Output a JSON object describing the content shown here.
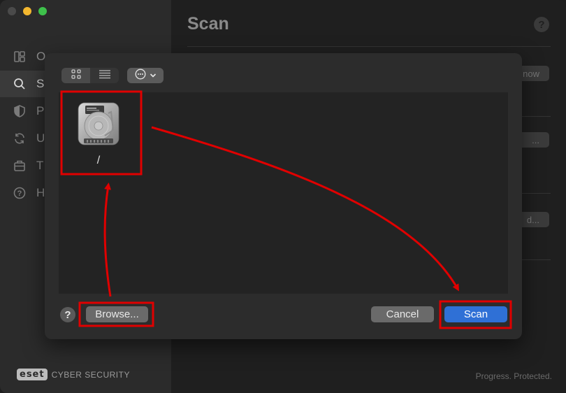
{
  "window": {
    "controls": [
      "close",
      "minimize",
      "maximize"
    ]
  },
  "sidebar": {
    "items": [
      {
        "label": "O",
        "icon": "overview-icon"
      },
      {
        "label": "S",
        "icon": "search-icon",
        "active": true
      },
      {
        "label": "P",
        "icon": "shield-icon"
      },
      {
        "label": "U",
        "icon": "refresh-icon"
      },
      {
        "label": "T",
        "icon": "briefcase-icon"
      },
      {
        "label": "H",
        "icon": "help-circle-icon"
      }
    ],
    "logo_mark": "eset",
    "logo_text": "CYBER SECURITY"
  },
  "main": {
    "title": "Scan",
    "help_label": "?",
    "buttons": [
      "now",
      "...",
      "d..."
    ],
    "footer": "Progress. Protected."
  },
  "dialog": {
    "toolbar": {
      "view_modes": [
        "grid-view-icon",
        "list-view-icon"
      ],
      "options_icon": "ellipsis-circle-icon"
    },
    "files": [
      {
        "name": "/",
        "icon": "hard-drive-icon"
      }
    ],
    "help_label": "?",
    "browse_label": "Browse...",
    "cancel_label": "Cancel",
    "scan_label": "Scan"
  },
  "annotations": {
    "highlight_color": "#e00000"
  }
}
